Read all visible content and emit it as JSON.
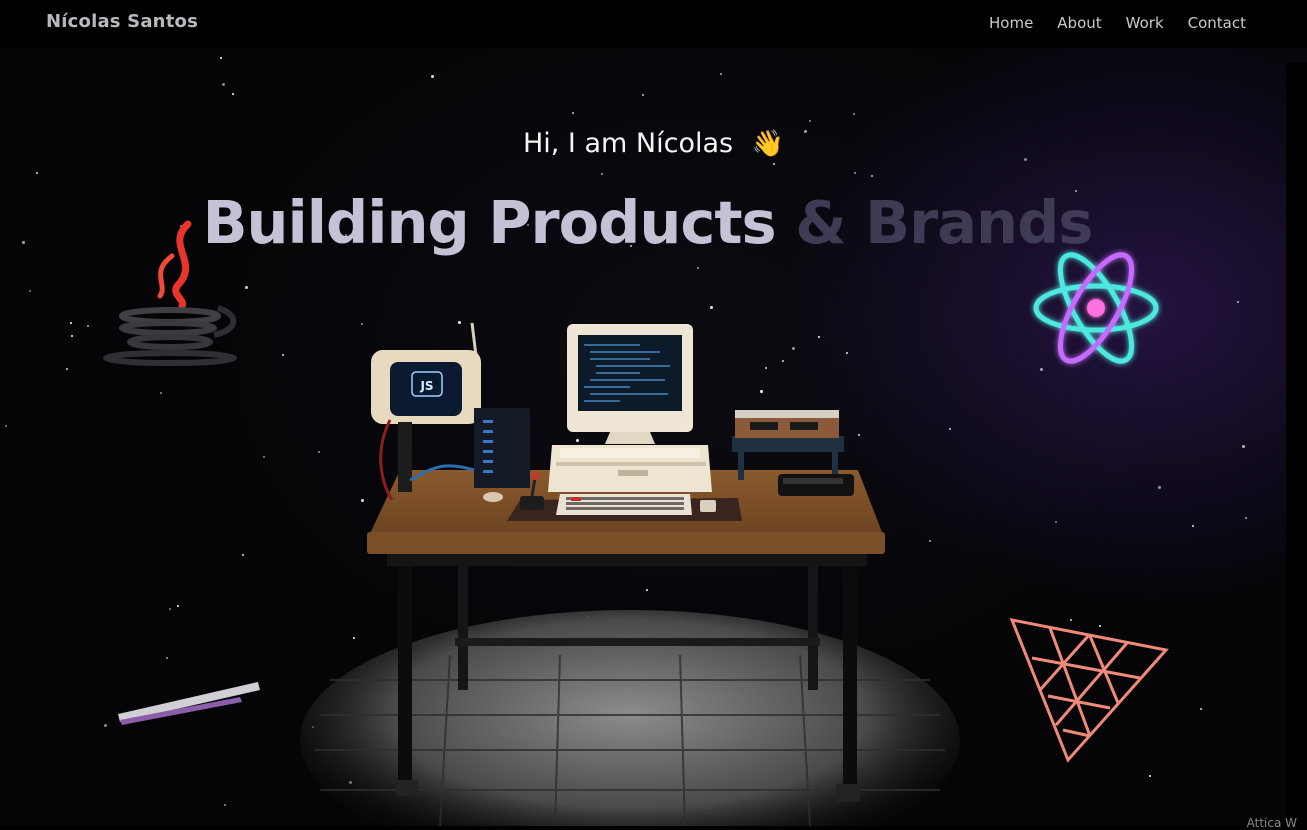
{
  "nav": {
    "brand": "Nícolas Santos",
    "links": [
      "Home",
      "About",
      "Work",
      "Contact"
    ]
  },
  "hero": {
    "greeting": "Hi, I am Nícolas",
    "wave": "👋",
    "headline_primary": "Building Products",
    "headline_secondary": "& Brands"
  },
  "scene": {
    "monitor_badge": "JS",
    "icons": [
      "java-icon",
      "react-icon",
      "threejs-icon",
      "stick-icon"
    ]
  },
  "colors": {
    "background": "#000000",
    "headline_primary": "#c4c3d6",
    "headline_secondary": "#3f3b55",
    "react_glow": "#4de8e0",
    "three_triangle": "#f08a78",
    "java_red": "#e8342a"
  },
  "footer": {
    "credit": "Attica  W"
  }
}
